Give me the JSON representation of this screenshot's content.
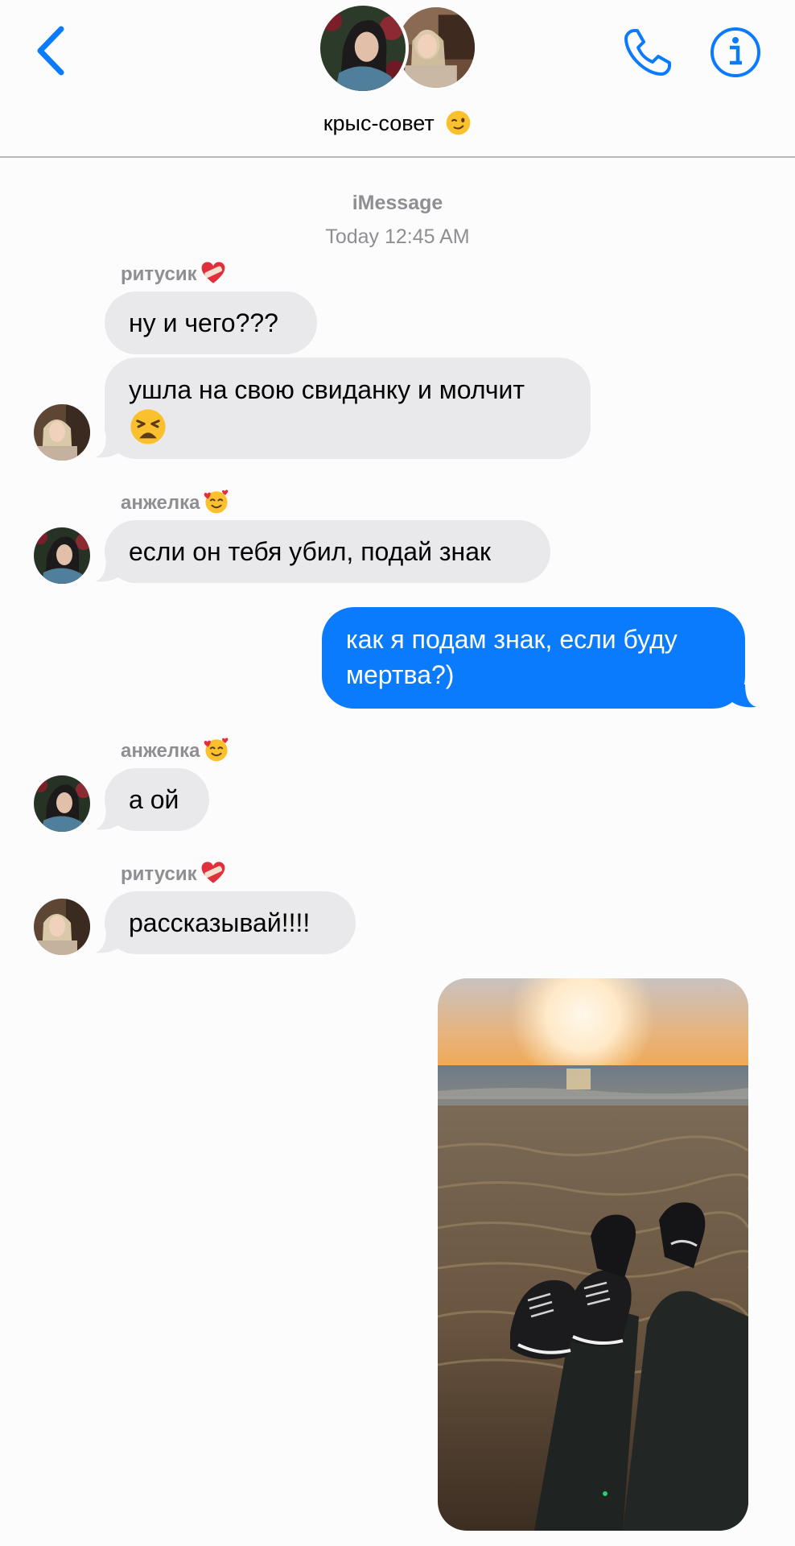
{
  "header": {
    "group_name": "крыс-совет",
    "group_emoji": "winking-face"
  },
  "thread": {
    "service": "iMessage",
    "timestamp": "Today 12:45 AM"
  },
  "messages": [
    {
      "sender": "ритусик",
      "sender_emoji": "heart-with-bandage",
      "text": "ну и чего???"
    },
    {
      "sender": "ритусик",
      "text": "ушла на свою свиданку и молчит",
      "trailing_emoji": "weary-face"
    },
    {
      "sender": "анжелка",
      "sender_emoji": "smiling-face-with-hearts",
      "text": "если он тебя убил, подай знак"
    },
    {
      "sender": "me",
      "text_line1": "как я подам знак, если буду",
      "text_line2": "мертва?)"
    },
    {
      "sender": "анжелка",
      "sender_emoji": "smiling-face-with-hearts",
      "text": "а ой"
    },
    {
      "sender": "ритусик",
      "sender_emoji": "heart-with-bandage",
      "text": "рассказывай!!!!"
    },
    {
      "sender": "me",
      "attachment": "photo-sunset-beach-sneakers"
    }
  ],
  "colors": {
    "accent": "#0b7bfe",
    "incoming_bubble": "#e9e9eb",
    "meta_text": "#8e8e93"
  }
}
